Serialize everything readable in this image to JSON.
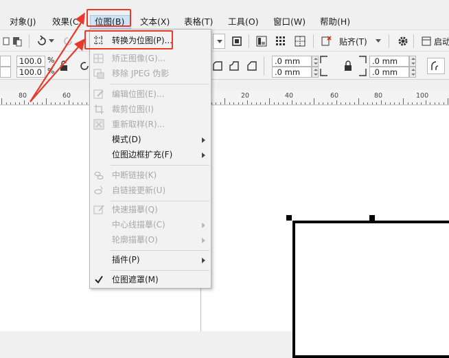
{
  "menubar": {
    "items": [
      {
        "label": "对象(J)"
      },
      {
        "label": "效果(C)"
      },
      {
        "label": "位图(B)"
      },
      {
        "label": "文本(X)"
      },
      {
        "label": "表格(T)"
      },
      {
        "label": "工具(O)"
      },
      {
        "label": "窗口(W)"
      },
      {
        "label": "帮助(H)"
      }
    ]
  },
  "toolbar": {
    "align_label": "贴齐(T)",
    "launch_label": "启动"
  },
  "propertybar": {
    "scale_x": "100.0",
    "scale_y": "100.0",
    "percent_x": "%",
    "percent_y": "%",
    "corner_1": ".0 mm",
    "corner_2": ".0 mm",
    "corner_3": ".0 mm",
    "corner_4": ".0 mm"
  },
  "ruler": {
    "labels": [
      "80",
      "60",
      "20",
      "40",
      "60",
      "80",
      "100"
    ]
  },
  "bitmap_menu": {
    "items": [
      {
        "label": "转换为位图(P)...",
        "enabled": true
      },
      {
        "label": "矫正图像(G)...",
        "enabled": false
      },
      {
        "label": "移除 JPEG 伪影",
        "enabled": false
      },
      {
        "label": "编辑位图(E)...",
        "enabled": false
      },
      {
        "label": "裁剪位图(I)",
        "enabled": false
      },
      {
        "label": "重新取样(R)...",
        "enabled": false
      },
      {
        "label": "模式(D)",
        "enabled": true
      },
      {
        "label": "位图边框扩充(F)",
        "enabled": true
      },
      {
        "label": "中断链接(K)",
        "enabled": false
      },
      {
        "label": "自链接更新(U)",
        "enabled": false
      },
      {
        "label": "快速描摹(Q)",
        "enabled": false
      },
      {
        "label": "中心线描摹(C)",
        "enabled": false
      },
      {
        "label": "轮廓描摹(O)",
        "enabled": false
      },
      {
        "label": "插件(P)",
        "enabled": true
      },
      {
        "label": "位图遮罩(M)",
        "enabled": true,
        "checked": true
      }
    ]
  },
  "colors": {
    "highlight": "#e8392b",
    "menu_active": "#cfe3f7"
  }
}
